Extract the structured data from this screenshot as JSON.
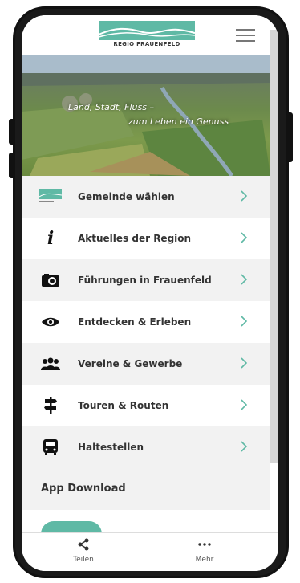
{
  "header": {
    "logo_text": "REGIO FRAUENFELD",
    "menu_icon": "hamburger-menu-icon"
  },
  "hero": {
    "tagline_line1": "Land, Stadt, Fluss –",
    "tagline_line2": "zum Leben ein Genuss"
  },
  "menu": {
    "items": [
      {
        "label": "Gemeinde wählen",
        "icon": "region-logo-icon"
      },
      {
        "label": "Aktuelles der Region",
        "icon": "info-icon"
      },
      {
        "label": "Führungen in Frauenfeld",
        "icon": "camera-icon"
      },
      {
        "label": "Entdecken & Erleben",
        "icon": "eye-icon"
      },
      {
        "label": "Vereine & Gewerbe",
        "icon": "group-icon"
      },
      {
        "label": "Touren & Routen",
        "icon": "signpost-icon"
      },
      {
        "label": "Haltestellen",
        "icon": "bus-icon"
      }
    ]
  },
  "download": {
    "title": "App Download"
  },
  "tabs": [
    {
      "label": "Teilen",
      "icon": "share-icon"
    },
    {
      "label": "Mehr",
      "icon": "more-dots-icon"
    }
  ],
  "colors": {
    "accent": "#5fb9a5",
    "chevron": "#5fb9a5",
    "row_alt": "#f2f2f2"
  }
}
